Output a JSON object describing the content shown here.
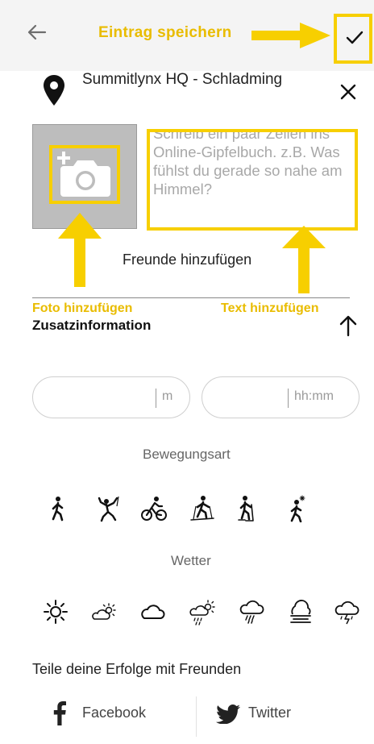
{
  "header": {
    "annotation_label": "Eintrag speichern",
    "back_icon": "arrow-left-icon",
    "save_icon": "checkmark-icon"
  },
  "location": {
    "name": "Summitlynx HQ - Schladming",
    "pin_icon": "map-pin-icon",
    "close_icon": "close-icon"
  },
  "entry": {
    "photo_icon": "add-photo-icon",
    "text_placeholder": "Schreib ein paar Zeilen ins Online-Gipfelbuch. z.B. Was fühlst du gerade so nahe am Himmel?",
    "friends_label": "Freunde hinzufügen"
  },
  "annotations": {
    "photo": "Foto hinzufügen",
    "text": "Text hinzufügen",
    "color": "#f7cf00"
  },
  "extra": {
    "title": "Zusatzinformation",
    "collapse_icon": "arrow-up-icon",
    "altitude_unit": "m",
    "duration_unit": "hh:mm",
    "movement_label": "Bewegungsart",
    "movement_icons": [
      "hiking-icon",
      "climbing-icon",
      "cycling-icon",
      "ski-touring-icon",
      "snowshoe-icon",
      "winter-hiking-icon"
    ],
    "weather_label": "Wetter",
    "weather_icons": [
      "sunny-icon",
      "partly-cloudy-icon",
      "cloudy-icon",
      "drizzle-sun-icon",
      "rain-icon",
      "fog-icon",
      "thunderstorm-icon"
    ]
  },
  "share": {
    "title": "Teile deine Erfolge mit Freunden",
    "facebook": "Facebook",
    "twitter": "Twitter"
  }
}
